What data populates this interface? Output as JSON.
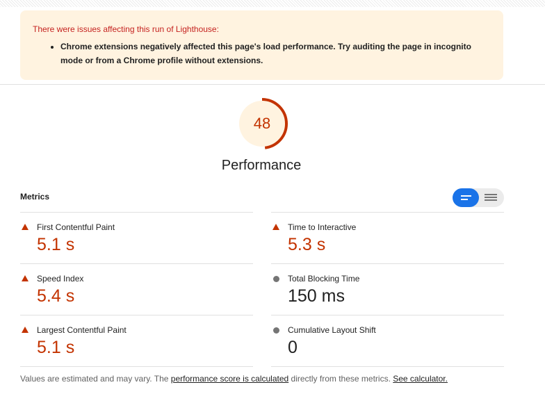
{
  "warning": {
    "title": "There were issues affecting this run of Lighthouse:",
    "items": [
      "Chrome extensions negatively affected this page's load performance. Try auditing the page in incognito mode or from a Chrome profile without extensions."
    ]
  },
  "gauge": {
    "score": "48",
    "score_fraction": 0.48,
    "label": "Performance",
    "color": "#c33300",
    "bg_color": "#fff3e0"
  },
  "metrics": {
    "title": "Metrics",
    "toggle": {
      "selected": "compact-view",
      "options": [
        "compact-view-icon",
        "expanded-view-icon"
      ]
    },
    "left": [
      {
        "label": "First Contentful Paint",
        "value": "5.1 s",
        "status": "fail"
      },
      {
        "label": "Speed Index",
        "value": "5.4 s",
        "status": "fail"
      },
      {
        "label": "Largest Contentful Paint",
        "value": "5.1 s",
        "status": "fail"
      }
    ],
    "right": [
      {
        "label": "Time to Interactive",
        "value": "5.3 s",
        "status": "fail"
      },
      {
        "label": "Total Blocking Time",
        "value": "150 ms",
        "status": "informative"
      },
      {
        "label": "Cumulative Layout Shift",
        "value": "0",
        "status": "informative"
      }
    ]
  },
  "footnote": {
    "prefix": "Values are estimated and may vary. The ",
    "link1": "performance score is calculated",
    "middle": " directly from these metrics. ",
    "link2": "See calculator."
  },
  "colors": {
    "fail": "#c33300",
    "neutral": "#757575",
    "accent": "#1a73e8"
  }
}
